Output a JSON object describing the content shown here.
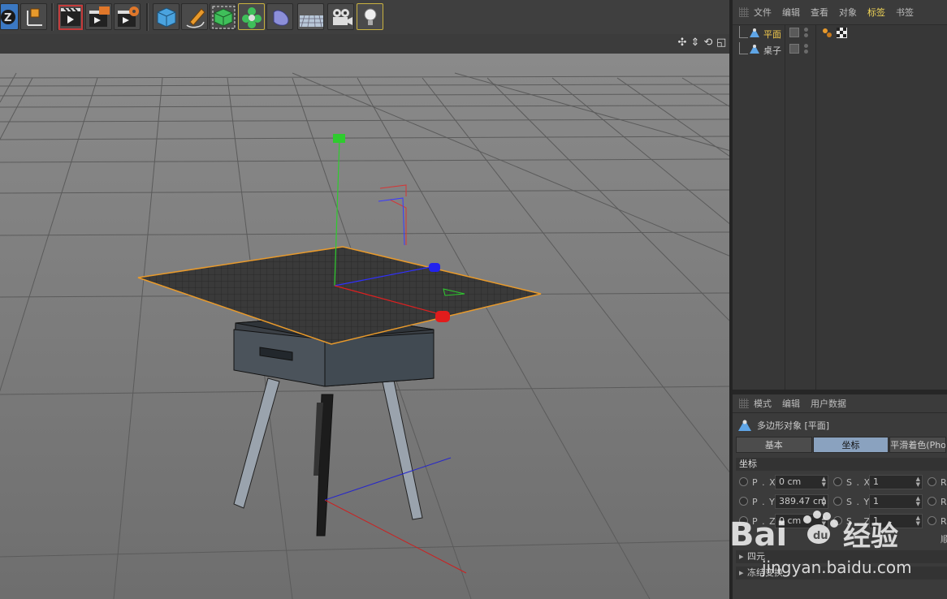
{
  "toolbar": {
    "buttons": [
      {
        "name": "cinema4d-logo-icon"
      },
      {
        "name": "coordinate-system-icon"
      },
      {
        "name": "render-view-icon"
      },
      {
        "name": "render-to-picture-viewer-icon"
      },
      {
        "name": "render-settings-icon"
      },
      {
        "name": "cube-primitive-icon"
      },
      {
        "name": "pen-spline-icon"
      },
      {
        "name": "subdivision-surface-icon"
      },
      {
        "name": "cloner-icon"
      },
      {
        "name": "deformer-icon"
      },
      {
        "name": "floor-icon"
      },
      {
        "name": "camera-icon"
      },
      {
        "name": "light-icon"
      }
    ]
  },
  "viewport": {
    "controls": [
      "move-view-icon",
      "zoom-view-icon",
      "rotate-view-icon",
      "toggle-layout-icon"
    ]
  },
  "object_manager": {
    "menu": [
      "文件",
      "编辑",
      "查看",
      "对象",
      "标签",
      "书签"
    ],
    "active_menu_index": 4,
    "objects": [
      {
        "label": "平面",
        "selected": true,
        "tags": [
          "phong-tag-icon",
          "material-tag-icon"
        ]
      },
      {
        "label": "桌子",
        "selected": false,
        "tags": []
      }
    ]
  },
  "attributes": {
    "menu": [
      "模式",
      "编辑",
      "用户数据"
    ],
    "title": "多边形对象 [平面]",
    "tabs": [
      "基本",
      "坐标",
      "平滑着色(Phong)"
    ],
    "active_tab": 1,
    "section": "坐标",
    "fields": [
      {
        "label": "P . X",
        "value": "0 cm",
        "s_label": "S . X",
        "s_value": "1",
        "r_label": "R"
      },
      {
        "label": "P . Y",
        "value": "389.47 cm",
        "s_label": "S . Y",
        "s_value": "1",
        "r_label": "R"
      },
      {
        "label": "P . Z",
        "value": "0 cm",
        "s_label": "S . Z",
        "s_value": "1",
        "r_label": "R"
      }
    ],
    "order_label": "顺",
    "collapsed": [
      "四元",
      "冻结变换"
    ]
  },
  "watermark": {
    "brand": "Bai",
    "brand2": "经验",
    "url": "jingyan.baidu.com"
  }
}
